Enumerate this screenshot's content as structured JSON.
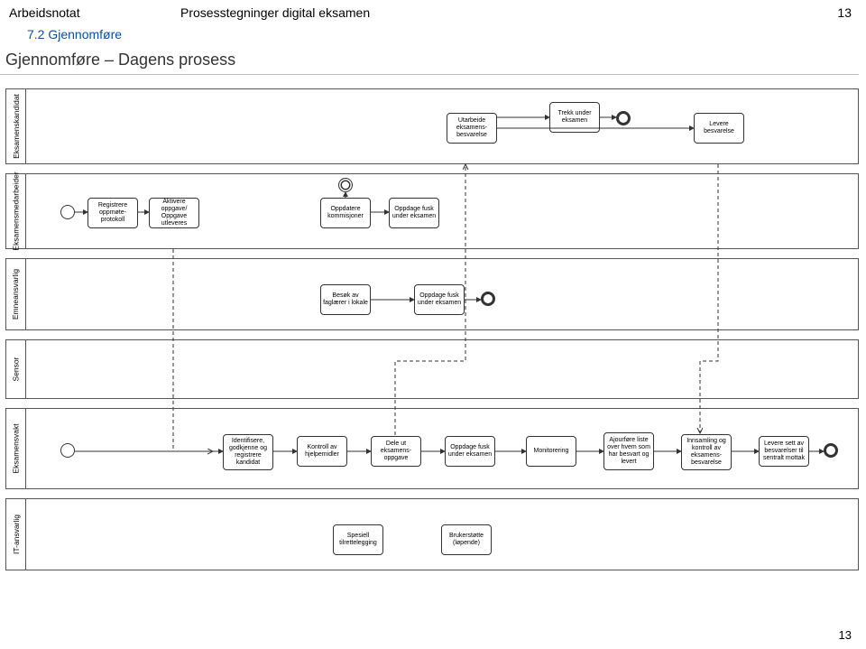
{
  "doc": {
    "header_left": "Arbeidsnotat",
    "header_center": "Prosesstegninger digital eksamen",
    "header_right": "13",
    "section_number": "7.2 Gjennomføre",
    "diagram_title": "Gjennomføre – Dagens prosess",
    "footer_page": "13"
  },
  "lanes": {
    "l1": "Eksamenskandidat",
    "l2": "Eksamensmedarbeider",
    "l3": "Emneansvarlig",
    "l4": "Sensor",
    "l5": "Eksamensvakt",
    "l6": "IT-ansvarlig"
  },
  "tasks": {
    "kand_utarbeide": "Utarbeide eksamens-besvarelse",
    "kand_trekk": "Trekk under eksamen",
    "kand_levere": "Levere besvarelse",
    "med_registrere": "Registrere oppmøte-protokoll",
    "med_aktivere": "Aktivere oppgave/ Oppgave utleveres",
    "med_oppdatere": "Oppdatere kommisjoner",
    "med_fusk": "Oppdage fusk under eksamen",
    "emne_besok": "Besøk av faglærer i lokale",
    "emne_fusk": "Oppdage fusk under eksamen",
    "vakt_identifisere": "Identifisere, godkjenne og registrere kandidat",
    "vakt_kontroll": "Kontroll av hjelpemidler",
    "vakt_deleut": "Dele ut eksamens-oppgave",
    "vakt_fusk": "Oppdage fusk under eksamen",
    "vakt_monitor": "Monitorering",
    "vakt_ajour": "Ajourføre liste over hvem som har besvart og levert",
    "vakt_innsamling": "Innsamling og kontroll av eksamens-besvarelse",
    "vakt_levere": "Levere sett av besvarelser til sentralt mottak",
    "it_spesiell": "Spesiell tilrettelegging",
    "it_bruker": "Brukerstøtte (løpende)"
  }
}
